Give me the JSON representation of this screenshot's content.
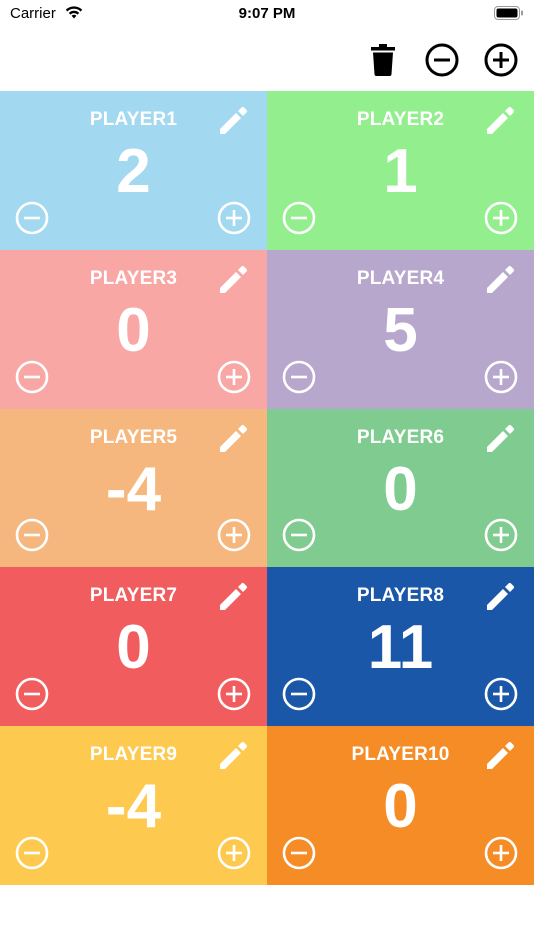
{
  "status_bar": {
    "carrier": "Carrier",
    "time": "9:07 PM"
  },
  "toolbar": {
    "icons": [
      "trash-icon",
      "minus-circle-icon",
      "plus-circle-icon"
    ]
  },
  "players": [
    {
      "name": "PLAYER1",
      "score": "2",
      "color": "#a2d8f0"
    },
    {
      "name": "PLAYER2",
      "score": "1",
      "color": "#93ee8e"
    },
    {
      "name": "PLAYER3",
      "score": "0",
      "color": "#f8a7a5"
    },
    {
      "name": "PLAYER4",
      "score": "5",
      "color": "#b7a7cd"
    },
    {
      "name": "PLAYER5",
      "score": "-4",
      "color": "#f5b77e"
    },
    {
      "name": "PLAYER6",
      "score": "0",
      "color": "#80cb8f"
    },
    {
      "name": "PLAYER7",
      "score": "0",
      "color": "#f15c5f"
    },
    {
      "name": "PLAYER8",
      "score": "11",
      "color": "#1a57a8"
    },
    {
      "name": "PLAYER9",
      "score": "-4",
      "color": "#fdc94f"
    },
    {
      "name": "PLAYER10",
      "score": "0",
      "color": "#f58c25"
    }
  ]
}
